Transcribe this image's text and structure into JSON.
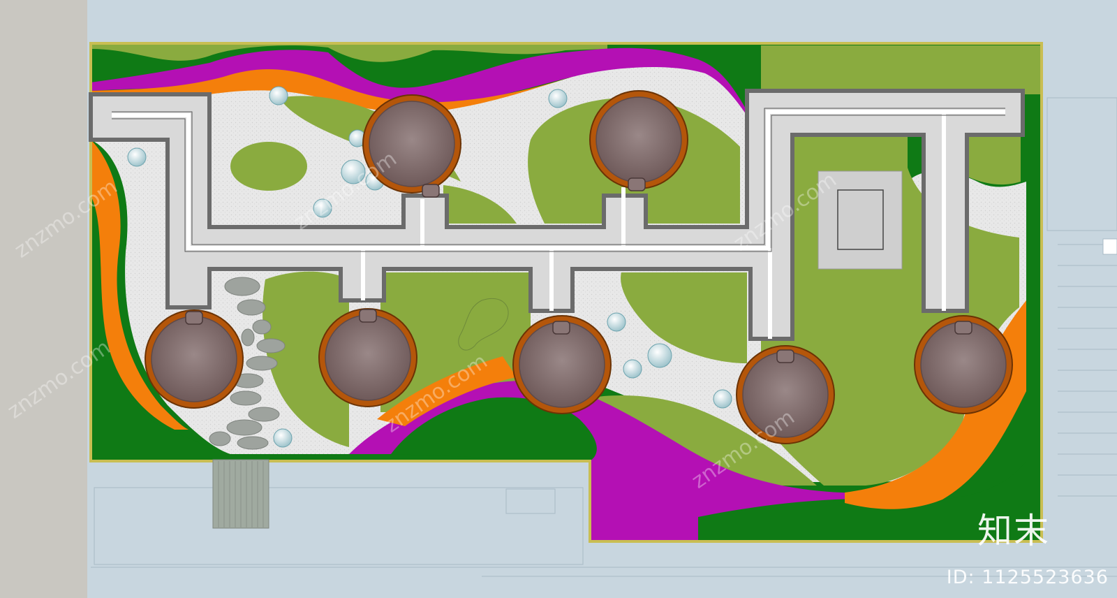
{
  "plan": {
    "colors": {
      "background": "#c8d6df",
      "left_panel": "#c9c7c1",
      "lawn_light": "#8aab3f",
      "lawn_dark": "#0f7a15",
      "magenta_bed": "#b410b4",
      "orange_bed": "#f47f0b",
      "gravel": "#e6e6e6",
      "pool_rim": "#b4560a",
      "pool_center": "#8d7b7b",
      "boardwalk": "#a0aaa0",
      "border": "#c9be52"
    },
    "elements": [
      "tree-pool",
      "stepping-stone",
      "shrub-ball",
      "boardwalk",
      "pavilion",
      "path"
    ]
  },
  "watermark": {
    "site_text": "znzmo.com",
    "logo_text": "知末",
    "id_text": "ID: 1125523636"
  }
}
